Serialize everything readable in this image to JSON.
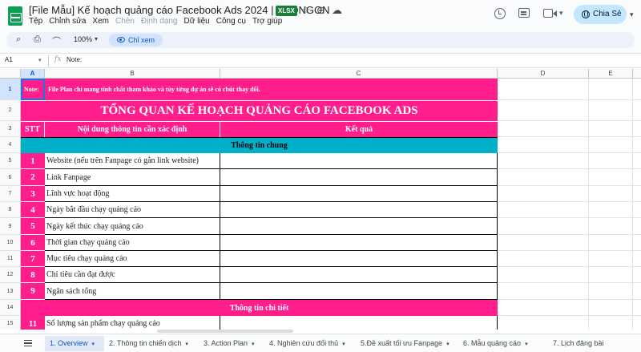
{
  "app": {
    "title": "[File Mẫu] Kế hoạch quảng cáo Facebook Ads 2024 | SEONGON",
    "badge": "XLSX",
    "menu": [
      {
        "label": "Tệp",
        "disabled": false
      },
      {
        "label": "Chỉnh sửa",
        "disabled": false
      },
      {
        "label": "Xem",
        "disabled": false
      },
      {
        "label": "Chèn",
        "disabled": true
      },
      {
        "label": "Định dạng",
        "disabled": true
      },
      {
        "label": "Dữ liệu",
        "disabled": false
      },
      {
        "label": "Công cụ",
        "disabled": false
      },
      {
        "label": "Trợ giúp",
        "disabled": false
      }
    ],
    "share_label": "Chia Sẻ"
  },
  "toolbar": {
    "zoom": "100%",
    "view_only_label": "Chỉ xem"
  },
  "formula": {
    "cell_ref": "A1",
    "content": "Note:"
  },
  "grid": {
    "columns": [
      {
        "label": "A",
        "selected": true
      },
      {
        "label": "B",
        "selected": false
      },
      {
        "label": "C",
        "selected": false
      },
      {
        "label": "D",
        "selected": false
      },
      {
        "label": "E",
        "selected": false
      }
    ],
    "row_numbers": [
      "1",
      "2",
      "3",
      "4",
      "5",
      "6",
      "7",
      "8",
      "9",
      "10",
      "11",
      "12",
      "13",
      "14",
      "15"
    ],
    "note_label": "Note:",
    "note_text": "File Plan chỉ mang tính chất tham khảo và tùy từng dự án sẽ có chút thay đổi.",
    "main_title": "TỔNG QUAN KẾ HOẠCH QUẢNG CÁO FACEBOOK ADS",
    "headers": {
      "stt": "STT",
      "content": "Nội dung thông tin cần xác định",
      "result": "Kết quả"
    },
    "section_general": "Thông tin chung",
    "items": [
      {
        "no": "1",
        "text": "Website (nếu trên Fanpage có gắn link website)"
      },
      {
        "no": "2",
        "text": "Link Fanpage"
      },
      {
        "no": "3",
        "text": "Lĩnh vực hoạt động"
      },
      {
        "no": "4",
        "text": "Ngày bắt đầu chạy quảng cáo"
      },
      {
        "no": "5",
        "text": "Ngày kết thúc chạy quảng cáo"
      },
      {
        "no": "6",
        "text": "Thời gian chạy quảng cáo"
      },
      {
        "no": "7",
        "text": "Mục tiêu chạy quảng cáo"
      },
      {
        "no": "8",
        "text": "Chỉ tiêu cần đạt được"
      },
      {
        "no": "9",
        "text": "Ngân sách tổng"
      }
    ],
    "section_detail": "Thông tin chi tiết",
    "item_detail": {
      "no": "11",
      "text": "Số lượng sản phẩm chạy quảng cáo"
    }
  },
  "sheets": [
    {
      "label": "1. Overview",
      "active": true
    },
    {
      "label": "2. Thông tin chiến dịch",
      "active": false
    },
    {
      "label": "3. Action Plan",
      "active": false
    },
    {
      "label": "4. Nghiên cứu đối thủ",
      "active": false
    },
    {
      "label": "5.Đề xuất tối ưu Fanpage",
      "active": false
    },
    {
      "label": "6. Mẫu quảng cáo",
      "active": false
    },
    {
      "label": "7. Lịch đăng bài",
      "active": false
    }
  ],
  "colors": {
    "pink": "#ff1e8c",
    "teal": "#00b0c8",
    "accent": "#0b57d0"
  }
}
